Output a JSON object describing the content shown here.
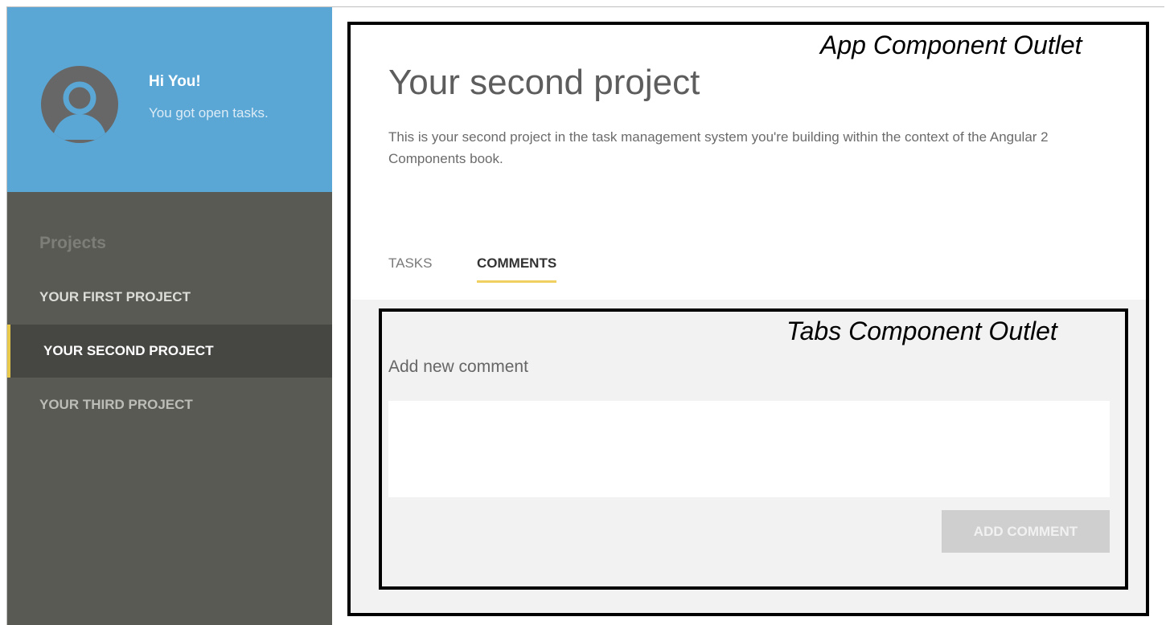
{
  "profile": {
    "greeting": "Hi You!",
    "subtitle": "You got open tasks.",
    "avatar_icon": "user-avatar-icon"
  },
  "sidebar": {
    "section_title": "Projects",
    "items": [
      {
        "label": "YOUR FIRST PROJECT"
      },
      {
        "label": "YOUR SECOND PROJECT",
        "active": true
      },
      {
        "label": "YOUR THIRD PROJECT"
      }
    ]
  },
  "annotations": {
    "app_outlet": "App Component Outlet",
    "tabs_outlet": "Tabs Component Outlet"
  },
  "project": {
    "title": "Your second project",
    "description": "This is your second project in the task management system you're building within the context of the Angular 2 Components book."
  },
  "tabs": [
    {
      "label": "TASKS"
    },
    {
      "label": "COMMENTS",
      "active": true
    }
  ],
  "comments": {
    "label": "Add new comment",
    "input_value": "",
    "button_label": "ADD COMMENT"
  },
  "colors": {
    "sidebar_bg": "#5a5a55",
    "profile_bg": "#5aa7d6",
    "active_accent": "#e8c84a",
    "tab_underline": "#f0d061"
  }
}
